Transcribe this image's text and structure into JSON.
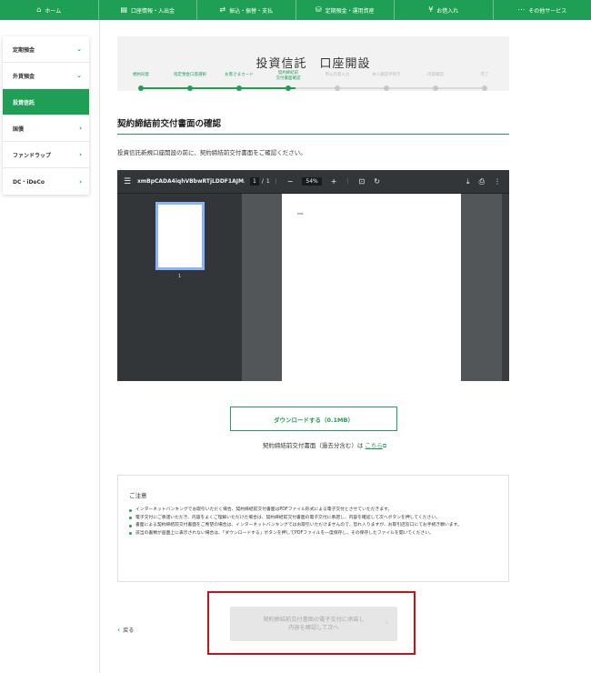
{
  "topnav": [
    {
      "icon": "⌂",
      "label": "ホーム"
    },
    {
      "icon": "▤",
      "label": "口座情報・入出金"
    },
    {
      "icon": "⇄",
      "label": "振込・振替・支払"
    },
    {
      "icon": "⛁",
      "label": "定期預金・運用資産"
    },
    {
      "icon": "¥",
      "label": "お借入れ"
    },
    {
      "icon": "⋯",
      "label": "その他サービス"
    }
  ],
  "sidebar": [
    {
      "label": "定期預金",
      "chev": "⌄"
    },
    {
      "label": "外貨預金",
      "chev": "⌄"
    },
    {
      "label": "投資信託",
      "chev": ""
    },
    {
      "label": "国債",
      "chev": "›"
    },
    {
      "label": "ファンドラップ",
      "chev": "›"
    },
    {
      "label": "DC・iDeCo",
      "chev": "›"
    }
  ],
  "page_title": "投資信託　口座開設",
  "steps": [
    {
      "label": "規約同意",
      "done": true
    },
    {
      "label": "指定預金口座選択",
      "done": true
    },
    {
      "label": "お客さまカード",
      "done": true
    },
    {
      "label": "契約締結前\n交付書面確認",
      "done": true
    },
    {
      "label": "申込内容入力",
      "done": false
    },
    {
      "label": "本人確認手続き",
      "done": false
    },
    {
      "label": "内容確認",
      "done": false
    },
    {
      "label": "完了",
      "done": false
    }
  ],
  "section_title": "契約締結前交付書面の確認",
  "intro_text": "投資信託新規口座開設の前に、契約締結前交付書面をご確認ください。",
  "pdf": {
    "filename": "xmBpCADA4iqhVBbwRTjLDDF1AJM...",
    "page_current": "1",
    "page_sep": "/",
    "page_total": "1",
    "zoom": "54%",
    "thumb_number": "1",
    "page_text": "test"
  },
  "download_button": "ダウンロードする（0.1MB）",
  "past_docs_text": "契約締結前交付書面（過去分含む）は",
  "past_docs_link": "こちら",
  "notice": {
    "title": "ご注意",
    "items": [
      "インターネットバンキングでお取引いただく場合、契約締結前交付書面はPDFファイル形式による電子交付とさせていただきます。",
      "電子交付にご承諾いただき、内容をよくご理解いただけた場合は、契約締結前交付書面の電子交付に承諾し、内容を確認して次へボタンを押してください。",
      "書面による契約締結前交付書面をご希望の場合は、インターネットバンキングではお取引いただけませんので、恐れ入りますが、お取引店窓口にてお手続き願います。",
      "該当の書類が画面上に表示されない場合は、「ダウンロードする」ボタンを押してPDFファイルを一度保存し、その保存したファイルを開いてください。"
    ]
  },
  "back_link": "戻る",
  "consent_button": "契約締結前交付書面の電子交付に承諾し\n内容を確認して次へ",
  "colors": {
    "brand_green": "#1f9f55",
    "highlight_red": "#c8101e"
  }
}
